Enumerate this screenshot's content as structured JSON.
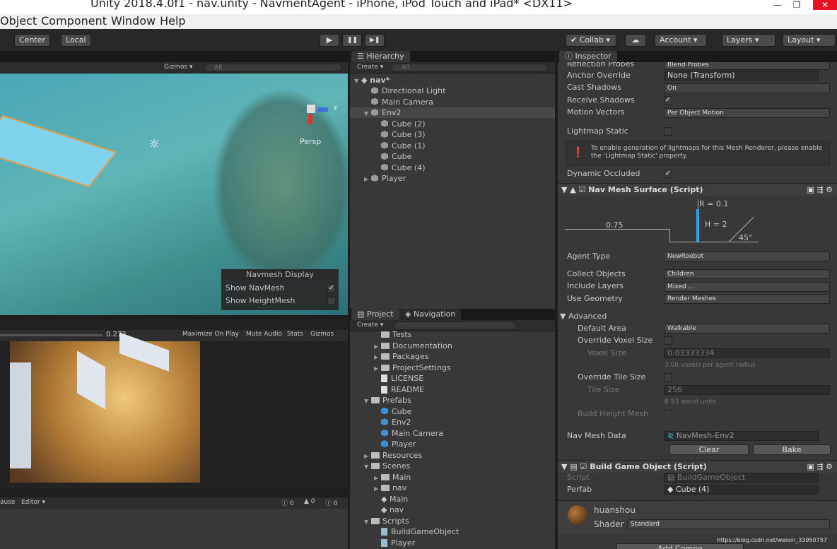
{
  "window": {
    "title": "Unity 2018.4.0f1 - nav.unity - NavmentAgent - iPhone, iPod Touch and iPad* <DX11>",
    "minimize": "—",
    "maximize": "❐",
    "close": "✕"
  },
  "menu": [
    "Object",
    "Component",
    "Window",
    "Help"
  ],
  "toolbar": {
    "center": "Center",
    "local": "Local",
    "play": "▶",
    "pause": "❚❚",
    "step": "▶❚",
    "collab": "✔ Collab ▾",
    "cloud": "☁",
    "account": "Account ▾",
    "layers": "Layers ▾",
    "layout": "Layout ▾"
  },
  "scene": {
    "gizmos": "Gizmos ▾",
    "search_placeholder": "All",
    "persp": "Persp",
    "axis_z": "z",
    "navmesh_display": {
      "title": "Navmesh Display",
      "show_navmesh": "Show NavMesh",
      "show_navmesh_checked": true,
      "show_heightmesh": "Show HeightMesh",
      "show_heightmesh_checked": false
    }
  },
  "game": {
    "scale": "0.272",
    "maximize": "Maximize On Play",
    "mute": "Mute Audio",
    "stats": "Stats",
    "gizmos": "Gizmos"
  },
  "console": {
    "pause": "ause",
    "editor": "Editor ▾",
    "errors": "0",
    "warnings": "0",
    "logs": "0"
  },
  "hierarchy": {
    "tab": "Hierarchy",
    "create": "Create ▾",
    "search_placeholder": "All",
    "scene": "nav*",
    "items": [
      {
        "label": "Directional Light",
        "depth": 1
      },
      {
        "label": "Main Camera",
        "depth": 1
      },
      {
        "label": "Env2",
        "depth": 1,
        "expanded": true,
        "selected": true
      },
      {
        "label": "Cube (2)",
        "depth": 2
      },
      {
        "label": "Cube (3)",
        "depth": 2
      },
      {
        "label": "Cube (1)",
        "depth": 2
      },
      {
        "label": "Cube",
        "depth": 2
      },
      {
        "label": "Cube (4)",
        "depth": 2
      },
      {
        "label": "Player",
        "depth": 1,
        "collapsed": true
      }
    ]
  },
  "project": {
    "tab1": "Project",
    "tab2": "Navigation",
    "create": "Create ▾",
    "items": [
      {
        "label": "Tests",
        "depth": 2,
        "type": "folder"
      },
      {
        "label": "Documentation",
        "depth": 2,
        "type": "folder",
        "arrow": true
      },
      {
        "label": "Packages",
        "depth": 2,
        "type": "folder",
        "arrow": true
      },
      {
        "label": "ProjectSettings",
        "depth": 2,
        "type": "folder",
        "arrow": true
      },
      {
        "label": "LICENSE",
        "depth": 2,
        "type": "file"
      },
      {
        "label": "README",
        "depth": 2,
        "type": "file"
      },
      {
        "label": "Prefabs",
        "depth": 1,
        "type": "folder",
        "open": true
      },
      {
        "label": "Cube",
        "depth": 2,
        "type": "prefab"
      },
      {
        "label": "Env2",
        "depth": 2,
        "type": "prefab"
      },
      {
        "label": "Main Camera",
        "depth": 2,
        "type": "prefab"
      },
      {
        "label": "Player",
        "depth": 2,
        "type": "prefab"
      },
      {
        "label": "Resources",
        "depth": 1,
        "type": "folder",
        "arrow": true
      },
      {
        "label": "Scenes",
        "depth": 1,
        "type": "folder",
        "open": true
      },
      {
        "label": "Main",
        "depth": 2,
        "type": "folder",
        "arrow": true
      },
      {
        "label": "nav",
        "depth": 2,
        "type": "folder",
        "arrow": true
      },
      {
        "label": "Main",
        "depth": 2,
        "type": "scene"
      },
      {
        "label": "nav",
        "depth": 2,
        "type": "scene"
      },
      {
        "label": "Scripts",
        "depth": 1,
        "type": "folder",
        "open": true
      },
      {
        "label": "BuildGameObject",
        "depth": 2,
        "type": "script"
      },
      {
        "label": "Player",
        "depth": 2,
        "type": "script"
      }
    ]
  },
  "inspector": {
    "tab": "Inspector",
    "renderer": {
      "reflection_probes": "Reflection Probes",
      "reflection_value": "Blend Probes",
      "anchor": "Anchor Override",
      "anchor_value": "None (Transform)",
      "cast": "Cast Shadows",
      "cast_value": "On",
      "receive": "Receive Shadows",
      "receive_checked": true,
      "motion": "Motion Vectors",
      "motion_value": "Per Object Motion",
      "lightmap": "Lightmap Static",
      "lightmap_checked": false,
      "info": "To enable generation of lightmaps for this Mesh Renderer, please enable the 'Lightmap Static' property.",
      "occluded": "Dynamic Occluded",
      "occluded_checked": true
    },
    "navmesh": {
      "title": "Nav Mesh Surface (Script)",
      "radius": "R = 0.1",
      "height": "H = 2",
      "step": "0.75",
      "slope": "45°",
      "agent_type": "Agent Type",
      "agent_value": "NewRoebot",
      "collect": "Collect Objects",
      "collect_value": "Children",
      "layers": "Include Layers",
      "layers_value": "Mixed ...",
      "geometry": "Use Geometry",
      "geometry_value": "Render Meshes",
      "advanced": "Advanced",
      "area": "Default Area",
      "area_value": "Walkable",
      "ovs": "Override Voxel Size",
      "voxel": "Voxel Size",
      "voxel_value": "0.03333334",
      "voxel_hint": "3.00 voxels per agent radius",
      "ots": "Override Tile Size",
      "tile": "Tile Size",
      "tile_value": "256",
      "tile_hint": "8.53 world units",
      "bhm": "Build Height Mesh",
      "data": "Nav Mesh Data",
      "data_value": "NavMesh-Env2",
      "clear": "Clear",
      "bake": "Bake"
    },
    "build": {
      "title": "Build Game Object (Script)",
      "script": "Script",
      "script_value": "BuildGameObject",
      "perfab": "Perfab",
      "perfab_value": "Cube (4)"
    },
    "material": {
      "name": "huanshou",
      "shader": "Shader",
      "shader_value": "Standard"
    },
    "add_component": "Add Compo"
  },
  "watermark": "https://blog.csdn.net/weixin_33950757"
}
